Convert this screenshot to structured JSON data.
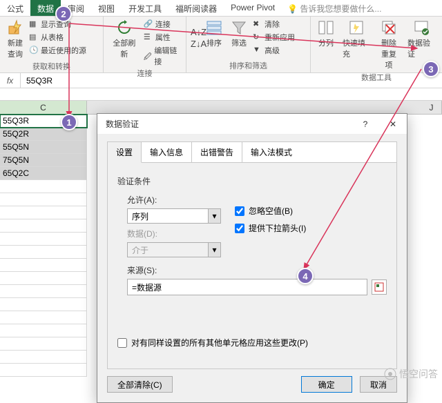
{
  "tabs": {
    "formula": "公式",
    "data": "数据",
    "review": "审阅",
    "view": "视图",
    "developer": "开发工具",
    "foxit": "福昕阅读器",
    "powerpivot": "Power Pivot",
    "tellme": "告诉我您想要做什么..."
  },
  "ribbon": {
    "get": {
      "newquery": "新建\n查询",
      "showquery": "显示查询",
      "fromtable": "从表格",
      "recent": "最近使用的源",
      "label": "获取和转换"
    },
    "conn": {
      "refreshall": "全部刷新",
      "connections": "连接",
      "properties": "属性",
      "editlinks": "编辑链接",
      "label": "连接"
    },
    "sort": {
      "sort": "排序",
      "filter": "筛选",
      "clear": "清除",
      "reapply": "重新应用",
      "advanced": "高级",
      "label": "排序和筛选"
    },
    "tools": {
      "texttocol": "分列",
      "flashfill": "快速填充",
      "removedup": "删除\n重复项",
      "validation": "数据验证",
      "label": "数据工具"
    }
  },
  "fx": {
    "label": "fx",
    "value": "55Q3R"
  },
  "cols": {
    "c": "C",
    "j": "J"
  },
  "cells": [
    "55Q3R",
    "55Q2R",
    "55Q5N",
    "75Q5N",
    "65Q2C"
  ],
  "dialog": {
    "title": "数据验证",
    "help": "?",
    "close": "✕",
    "tabs": {
      "settings": "设置",
      "input": "输入信息",
      "error": "出错警告",
      "ime": "输入法模式"
    },
    "section": "验证条件",
    "allow": "允许(A):",
    "allow_val": "序列",
    "data": "数据(D):",
    "data_val": "介于",
    "ignore": "忽略空值(B)",
    "dropdown": "提供下拉箭头(I)",
    "source": "来源(S):",
    "source_val": "=数据源",
    "applyall": "对有同样设置的所有其他单元格应用这些更改(P)",
    "clearall": "全部清除(C)",
    "ok": "确定",
    "cancel": "取消"
  },
  "anno": {
    "a1": "1",
    "a2": "2",
    "a3": "3",
    "a4": "4"
  },
  "watermark": "悟空问答"
}
